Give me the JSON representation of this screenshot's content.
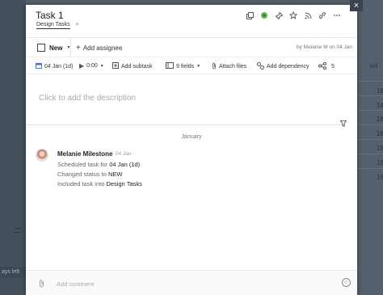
{
  "background": {
    "left_bottom_text": "ays left",
    "right_numbers": [
      "18",
      "14",
      "18",
      "18",
      "15",
      "15",
      "16"
    ],
    "right_small": "ed"
  },
  "task": {
    "title": "Task 1",
    "folder_tag": "Design Tasks",
    "add_tag_label": "+"
  },
  "header_icons": [
    "copy-icon",
    "pin-green-icon",
    "pin-icon",
    "star-icon",
    "rss-icon",
    "link-icon",
    "more-icon"
  ],
  "status": {
    "label": "New",
    "add_assignee": "Add assignee",
    "byline": "by Melanie M on 04 Jan"
  },
  "toolbar": {
    "date": "04 Jan (1d)",
    "timer": "0:00",
    "add_subtask": "Add subtask",
    "fields": "9 fields",
    "attach": "Attach files",
    "dependency": "Add dependency",
    "share_count": "5"
  },
  "description": {
    "placeholder": "Click to add the description"
  },
  "activity": {
    "month": "January",
    "author": "Melanie Milestone",
    "date": "04 Jan",
    "lines": [
      {
        "prefix": "Scheduled task for ",
        "value": "04 Jan (1d)"
      },
      {
        "prefix": "Changed status to ",
        "value": "NEW"
      },
      {
        "prefix": "Included task into ",
        "value": "Design Tasks"
      }
    ]
  },
  "comment": {
    "placeholder": "Add comment"
  },
  "close_label": "×"
}
